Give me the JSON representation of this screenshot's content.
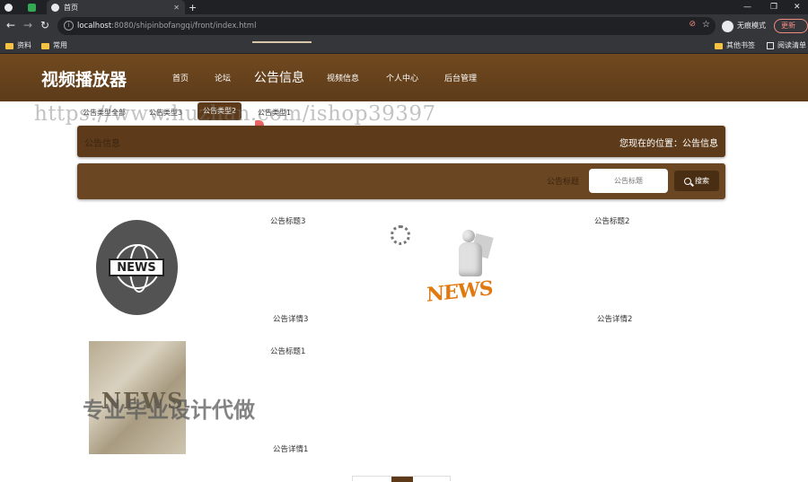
{
  "browser": {
    "tabs": [
      {
        "label": ""
      },
      {
        "label": ""
      },
      {
        "label": "首页"
      }
    ],
    "new_tab": "+",
    "window_controls": [
      "—",
      "❐",
      "✕"
    ],
    "url_host": "localhost",
    "url_rest": ":8080/shipinbofangqi/front/index.html",
    "incognito_label": "无痕模式",
    "update_label": "更新",
    "bookmarks": [
      {
        "label": "资料"
      },
      {
        "label": "常用"
      }
    ],
    "bookmarks_right": [
      {
        "label": "其他书签"
      },
      {
        "label": "阅读清单"
      }
    ]
  },
  "site": {
    "brand": "视频播放器",
    "nav": [
      {
        "label": "首页"
      },
      {
        "label": "论坛"
      },
      {
        "label": "公告信息"
      },
      {
        "label": "视频信息"
      },
      {
        "label": "个人中心"
      },
      {
        "label": "后台管理"
      }
    ],
    "active_nav_index": 2
  },
  "categories": [
    {
      "label": "公告类型全部"
    },
    {
      "label": "公告类型3"
    },
    {
      "label": "公告类型2"
    },
    {
      "label": "公告类型1"
    }
  ],
  "active_category_index": 2,
  "location": {
    "title": "公告信息",
    "path": "您现在的位置：公告信息"
  },
  "search": {
    "label": "公告标题",
    "placeholder": "公告标题",
    "button": "搜索"
  },
  "cards": [
    {
      "title": "公告标题3",
      "detail": "公告详情3",
      "image": "news-globe-icon"
    },
    {
      "title": "公告标题2",
      "detail": "公告详情2",
      "image": "news-figure-image"
    },
    {
      "title": "公告标题1",
      "detail": "公告详情1",
      "image": "news-letters-photo"
    }
  ],
  "watermarks": {
    "url": "https://www.huzhan.com/ishop39397",
    "cn": "专业毕业设计代做"
  },
  "colors": {
    "header_brown": "#6b4622",
    "dark_brown": "#5d3b1a",
    "accent_orange": "#e07a10"
  }
}
